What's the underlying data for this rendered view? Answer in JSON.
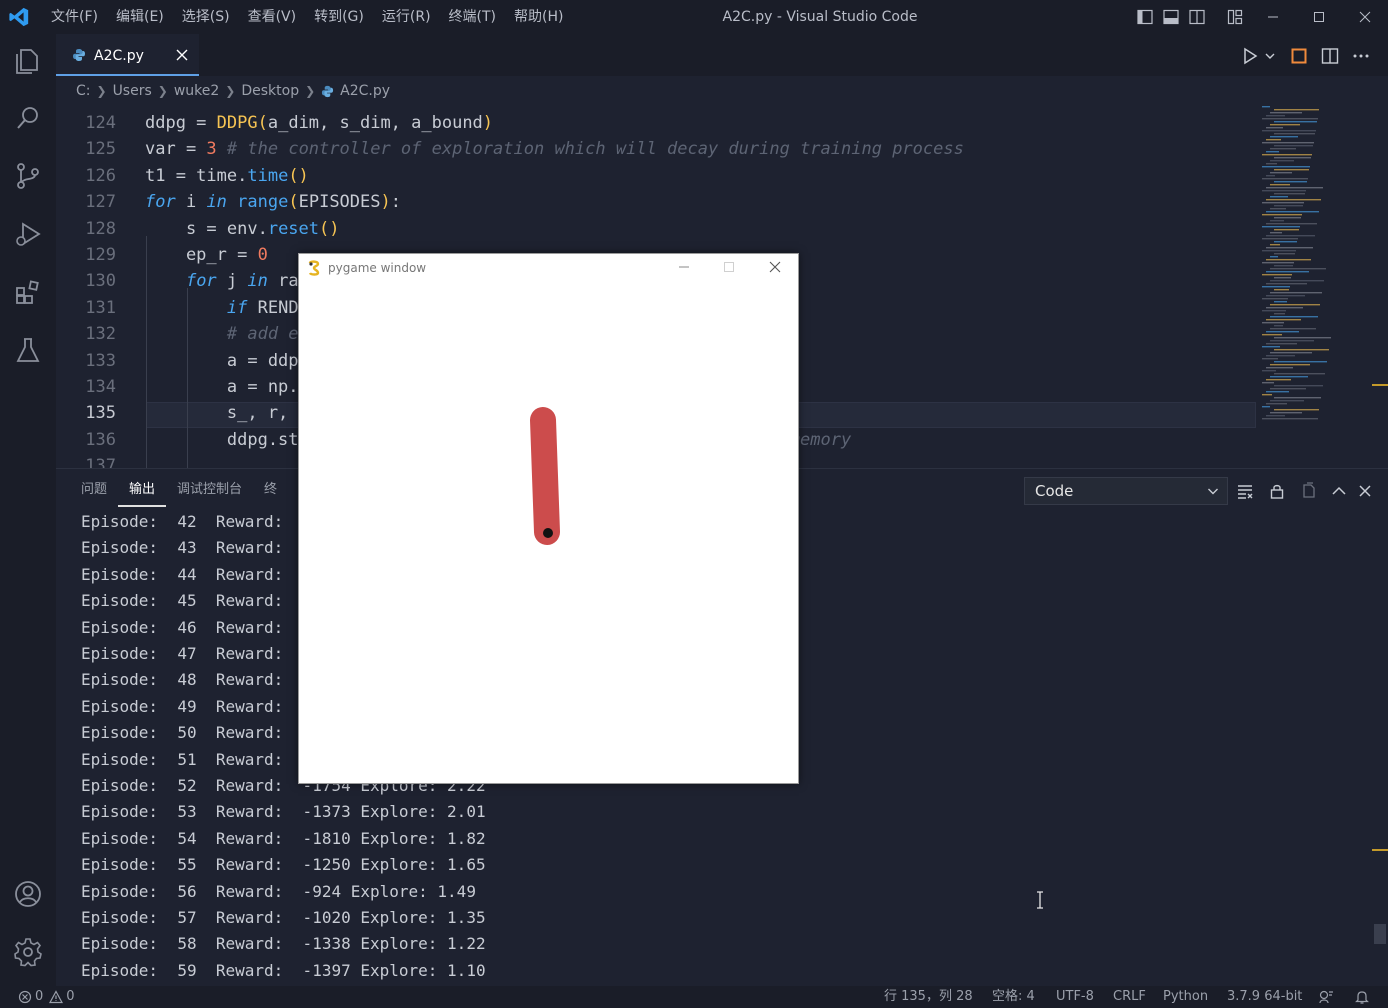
{
  "titlebar": {
    "menu": [
      "文件(F)",
      "编辑(E)",
      "选择(S)",
      "查看(V)",
      "转到(G)",
      "运行(R)",
      "终端(T)",
      "帮助(H)"
    ],
    "title": "A2C.py - Visual Studio Code"
  },
  "tab": {
    "label": "A2C.py"
  },
  "breadcrumb": [
    "C:",
    "Users",
    "wuke2",
    "Desktop",
    "A2C.py"
  ],
  "editor": {
    "lines": [
      {
        "n": "124",
        "html": "ddpg = <span class='cls'>DDPG</span><span class='par'>(</span>a_dim, s_dim, a_bound<span class='par'>)</span>"
      },
      {
        "n": "125",
        "html": "var = <span class='num'>3</span> <span class='cm'># the controller of exploration which will decay during training process</span>"
      },
      {
        "n": "126",
        "html": "t1 = time.<span class='fn'>time</span><span class='par'>()</span>"
      },
      {
        "n": "127",
        "html": "<span class='kw'>for</span> i <span class='kw'>in</span> <span class='fn'>range</span><span class='par'>(</span>EPISODES<span class='par'>)</span>:"
      },
      {
        "n": "128",
        "html": "    s = env.<span class='fn'>reset</span><span class='par'>()</span>"
      },
      {
        "n": "129",
        "html": "    ep_r = <span class='num'>0</span>"
      },
      {
        "n": "130",
        "html": "    <span class='kw'>for</span> j <span class='kw'>in</span> ra"
      },
      {
        "n": "131",
        "html": "        <span class='kw'>if</span> REND"
      },
      {
        "n": "132",
        "html": "        <span class='cm'># add e</span>"
      },
      {
        "n": "133",
        "html": "        a = ddp"
      },
      {
        "n": "134",
        "html": "        a = np.                                     ound<span class='par'>)</span>"
      },
      {
        "n": "135",
        "html": "        s_, r,"
      },
      {
        "n": "136",
        "html": "        ddpg.st                                    <span class='cm'>ansition to memory</span>"
      },
      {
        "n": "137",
        "html": ""
      }
    ],
    "current_line": "135"
  },
  "panel": {
    "tabs": [
      "问题",
      "输出",
      "调试控制台",
      "终"
    ],
    "active_tab": "输出",
    "select_value": "Code",
    "output": [
      "Episode:  42  Reward:",
      "Episode:  43  Reward:",
      "Episode:  44  Reward:",
      "Episode:  45  Reward:",
      "Episode:  46  Reward:",
      "Episode:  47  Reward:",
      "Episode:  48  Reward:",
      "Episode:  49  Reward:",
      "Episode:  50  Reward:",
      "Episode:  51  Reward:",
      "Episode:  52  Reward:  -1754 Explore: 2.22",
      "Episode:  53  Reward:  -1373 Explore: 2.01",
      "Episode:  54  Reward:  -1810 Explore: 1.82",
      "Episode:  55  Reward:  -1250 Explore: 1.65",
      "Episode:  56  Reward:  -924 Explore: 1.49",
      "Episode:  57  Reward:  -1020 Explore: 1.35",
      "Episode:  58  Reward:  -1338 Explore: 1.22",
      "Episode:  59  Reward:  -1397 Explore: 1.10"
    ]
  },
  "pygame": {
    "title": "pygame window"
  },
  "statusbar": {
    "errors": "0",
    "warnings": "0",
    "position": "行 135，列 28",
    "spaces": "空格: 4",
    "encoding": "UTF-8",
    "eol": "CRLF",
    "language": "Python",
    "interpreter": "3.7.9 64-bit"
  },
  "colors": {
    "background": "#1e2230",
    "keyword": "#4aa6f0",
    "number": "#f07a5f",
    "comment": "#5d6474",
    "accent": "#5fa0e6",
    "pendulum": "#cc4c4c"
  }
}
